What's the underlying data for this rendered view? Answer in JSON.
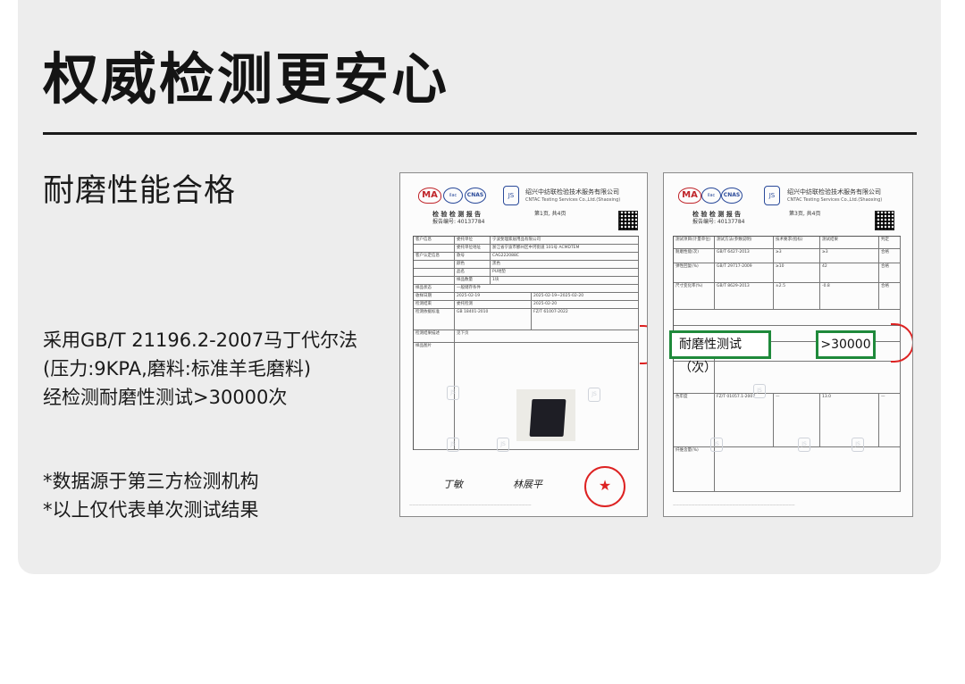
{
  "title": "权威检测更安心",
  "subtitle": "耐磨性能合格",
  "description_lines": [
    "采用GB/T 21196.2-2007马丁代尔法",
    "(压力:9KPA,磨料:标准羊毛磨料)",
    "经检测耐磨性测试>30000次"
  ],
  "notes": [
    "*数据源于第三方检测机构",
    "*以上仅代表单次测试结果"
  ],
  "report_left": {
    "logo_ma": "MA",
    "company_cn": "绍兴中纺联检验技术服务有限公司",
    "company_en": "CNTAC Testing Services Co.,Ltd.(Shaoxing)",
    "report_title": "检 验 检 测 报 告",
    "report_no": "报告编号: 40137784",
    "page": "第1页, 共4页",
    "rows": [
      [
        "客户信息",
        "委托单位",
        "宁波斐理家居用品有限公司"
      ],
      [
        "",
        "委托单位地址",
        "浙江省宁波市鄞州区中河街道 101号 ACMDTEM"
      ],
      [
        "客户认定信息",
        "款号",
        "CAG222088C"
      ],
      [
        "",
        "颜色",
        "黑色"
      ],
      [
        "",
        "品名",
        "PU地垫"
      ],
      [
        "",
        "样品数量",
        "1块"
      ],
      [
        "样品状态",
        "一般储存条件",
        ""
      ],
      [
        "收样日期",
        "2025-02-19",
        "2025-02-19~2025-02-20"
      ],
      [
        "检测结束",
        "委托检测",
        "2025-02-20"
      ],
      [
        "检测依据标准",
        "GB 18401-2010",
        "FZ/T 61007-2022"
      ],
      [
        "检测结果描述",
        "见下页",
        ""
      ],
      [
        "样品图片",
        "",
        ""
      ]
    ],
    "signature_1": "丁敏",
    "signature_2": "林展平"
  },
  "report_right": {
    "logo_ma": "MA",
    "company_cn": "绍兴中纺联检验技术服务有限公司",
    "company_en": "CNTAC Testing Services Co.,Ltd.(Shaoxing)",
    "report_title": "检 验 检 测 报 告",
    "report_no": "报告编号: 40137784",
    "page": "第3页, 共4页",
    "header_cols": [
      "测试项目(计量单位)",
      "测试方法(参数说明)",
      "技术要求(指标)",
      "测试结果",
      "判定"
    ],
    "rows": [
      [
        "耐磨性能(次)",
        "GB/T 6427-2013",
        "≥3",
        "≥3",
        "合格"
      ],
      [
        "弹性回复(%)",
        "GB/T 29717-2009",
        "≥10",
        "42",
        "合格"
      ],
      [
        "尺寸变化率(%)",
        "GB/T 8629-2013",
        "±2.5",
        "-0.8",
        "合格"
      ],
      [
        "色牢度",
        "FZ/T 01057.1-2007",
        "—",
        "13.0",
        "—"
      ],
      [
        "纤维含量(%)",
        "FZ/T 01057.4-2007",
        "—",
        "27.0",
        "—"
      ]
    ],
    "highlight_label": "耐磨性测试（次）",
    "highlight_value": ">30000"
  }
}
